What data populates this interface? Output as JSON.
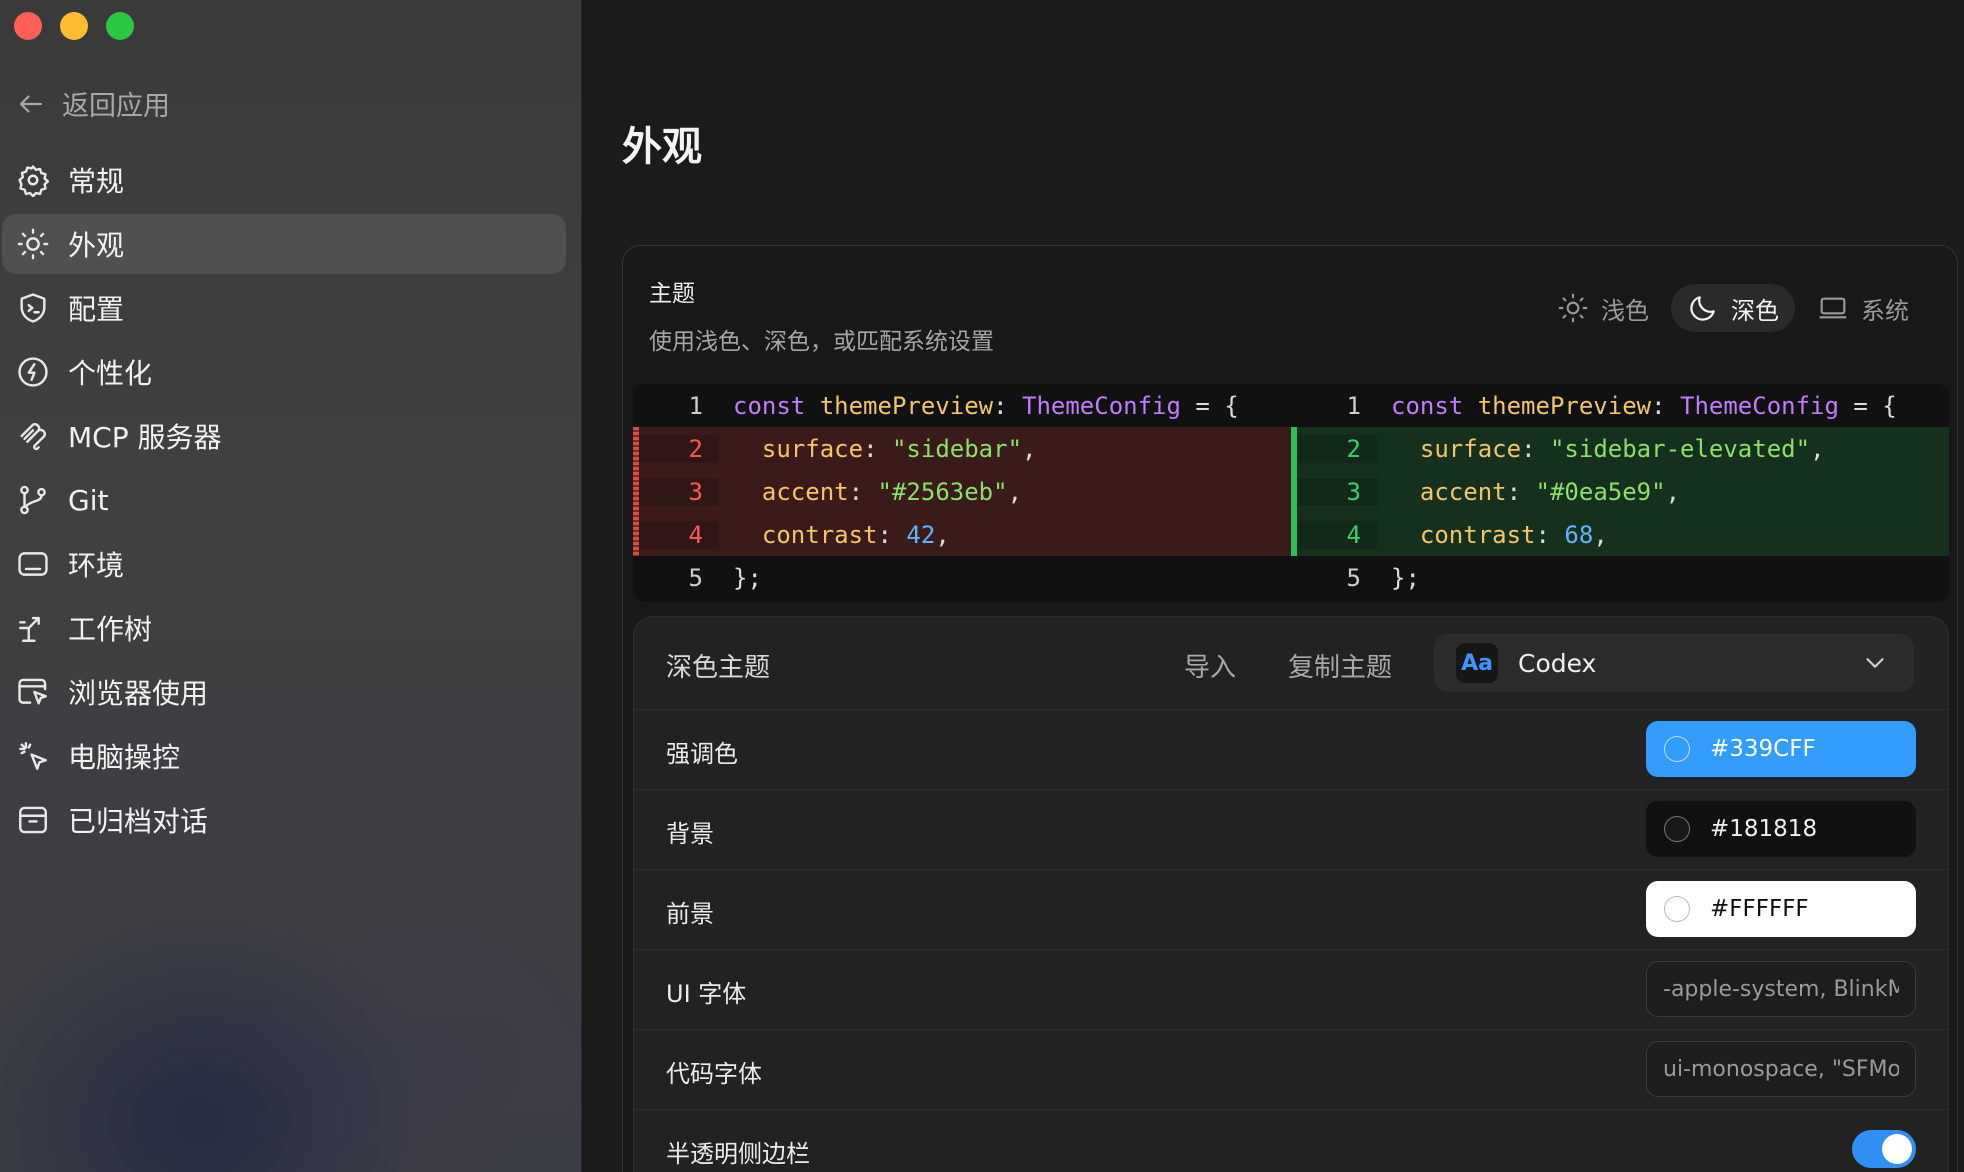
{
  "sidebar": {
    "back_label": "返回应用",
    "items": [
      {
        "label": "常规",
        "icon": "gear-icon"
      },
      {
        "label": "外观",
        "icon": "sun-icon",
        "active": true
      },
      {
        "label": "配置",
        "icon": "terminal-shield-icon"
      },
      {
        "label": "个性化",
        "icon": "personalize-icon"
      },
      {
        "label": "MCP 服务器",
        "icon": "mcp-icon"
      },
      {
        "label": "Git",
        "icon": "git-branch-icon"
      },
      {
        "label": "环境",
        "icon": "environment-icon"
      },
      {
        "label": "工作树",
        "icon": "worktree-icon"
      },
      {
        "label": "浏览器使用",
        "icon": "browser-cursor-icon"
      },
      {
        "label": "电脑操控",
        "icon": "computer-control-icon"
      },
      {
        "label": "已归档对话",
        "icon": "archive-icon"
      }
    ]
  },
  "main": {
    "title": "外观",
    "theme": {
      "heading": "主题",
      "description": "使用浅色、深色，或匹配系统设置",
      "options": {
        "light": "浅色",
        "dark": "深色",
        "system": "系统"
      },
      "selected": "dark"
    },
    "diff": {
      "left": {
        "numbers": [
          "1",
          "2",
          "3",
          "4",
          "5"
        ],
        "l1": {
          "kw": "const",
          "name": "themePreview",
          "colon": ":",
          "type": "ThemeConfig",
          "eq": "= {"
        },
        "l2": {
          "prop": "surface",
          "colon": ":",
          "val": "\"sidebar\"",
          "tail": ","
        },
        "l3": {
          "prop": "accent",
          "colon": ":",
          "val": "\"#2563eb\"",
          "tail": ","
        },
        "l4": {
          "prop": "contrast",
          "colon": ":",
          "val": "42",
          "tail": ","
        },
        "l5": "};"
      },
      "right": {
        "numbers": [
          "1",
          "2",
          "3",
          "4",
          "5"
        ],
        "l1": {
          "kw": "const",
          "name": "themePreview",
          "colon": ":",
          "type": "ThemeConfig",
          "eq": "= {"
        },
        "l2": {
          "prop": "surface",
          "colon": ":",
          "val": "\"sidebar-elevated\"",
          "tail": ","
        },
        "l3": {
          "prop": "accent",
          "colon": ":",
          "val": "\"#0ea5e9\"",
          "tail": ","
        },
        "l4": {
          "prop": "contrast",
          "colon": ":",
          "val": "68",
          "tail": ","
        },
        "l5": "};"
      }
    },
    "dark_theme": {
      "title": "深色主题",
      "import_label": "导入",
      "copy_label": "复制主题",
      "selector_badge": "Aa",
      "selector_value": "Codex",
      "rows": {
        "accent": {
          "label": "强调色",
          "value": "#339CFF"
        },
        "background": {
          "label": "背景",
          "value": "#181818"
        },
        "foreground": {
          "label": "前景",
          "value": "#FFFFFF"
        },
        "ui_font": {
          "label": "UI 字体",
          "value": "-apple-system, BlinkM"
        },
        "code_font": {
          "label": "代码字体",
          "value": "ui-monospace, \"SFMo"
        },
        "translucent": {
          "label": "半透明侧边栏",
          "enabled": true
        }
      }
    }
  },
  "colors": {
    "accent": "#339CFF",
    "background": "#181818",
    "foreground": "#FFFFFF"
  }
}
